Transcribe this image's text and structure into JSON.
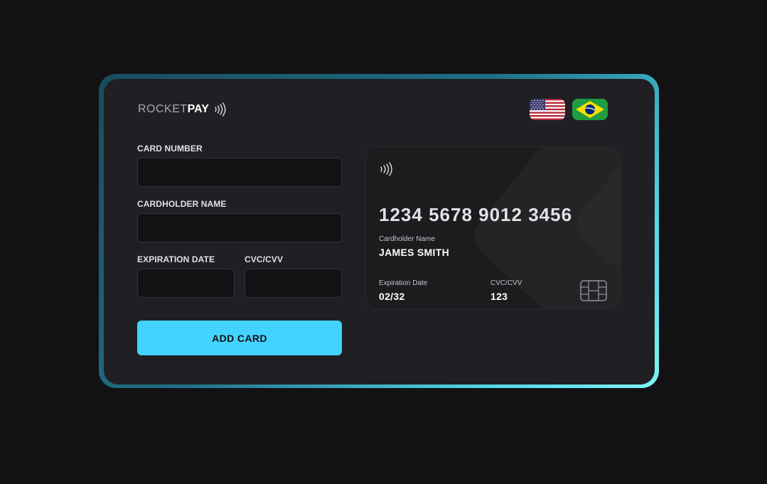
{
  "brand": {
    "part1": "ROCKET",
    "part2": "PAY",
    "contactless_icon": "contactless-icon"
  },
  "flags": [
    {
      "name": "us-flag-icon",
      "language": "en"
    },
    {
      "name": "brazil-flag-icon",
      "language": "pt"
    }
  ],
  "form": {
    "card_number_label": "CARD NUMBER",
    "card_number_value": "",
    "cardholder_label": "CARDHOLDER NAME",
    "cardholder_value": "",
    "expiration_label": "EXPIRATION DATE",
    "expiration_value": "",
    "cvc_label": "CVC/CVV",
    "cvc_value": "",
    "submit_label": "ADD CARD"
  },
  "card": {
    "number": "1234 5678 9012 3456",
    "holder_caption": "Cardholder Name",
    "holder_value": "JAMES SMITH",
    "expiration_caption": "Expiration Date",
    "expiration_value": "02/32",
    "cvc_caption": "CVC/CVV",
    "cvc_value": "123",
    "chip_icon": "chip-icon"
  },
  "colors": {
    "background": "#121214",
    "panel": "#202024",
    "accent": "#42d3ff",
    "input_bg": "#121214",
    "frame_gradient_end": "#7ff3f6"
  }
}
